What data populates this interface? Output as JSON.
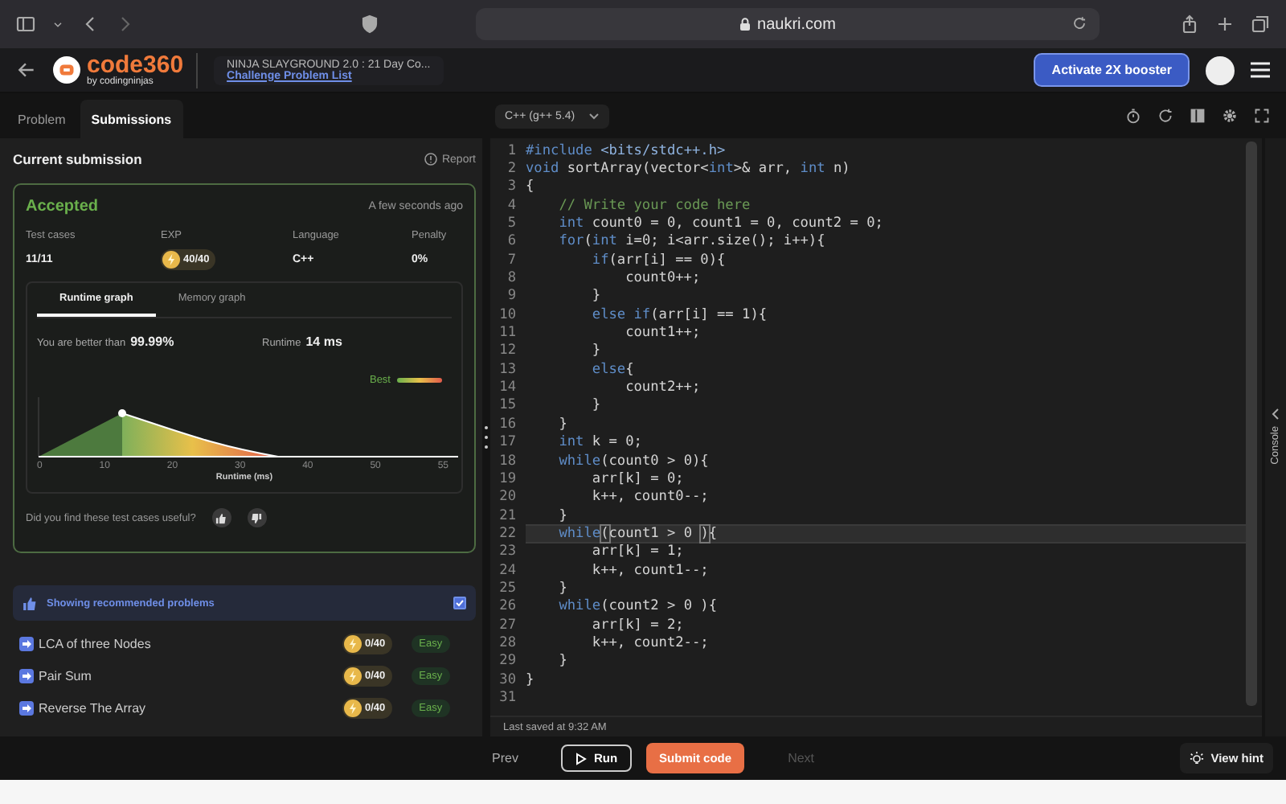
{
  "browser": {
    "url": "naukri.com"
  },
  "header": {
    "logo": {
      "name": "code360",
      "byline": "by codingninjas"
    },
    "title": "NINJA SLAYGROUND 2.0 : 21 Day Co...",
    "link": "Challenge Problem List",
    "booster_button": "Activate 2X booster"
  },
  "tabs": [
    {
      "label": "Problem",
      "selected": false
    },
    {
      "label": "Submissions",
      "selected": true
    }
  ],
  "submission": {
    "heading": "Current submission",
    "report": "Report",
    "status": "Accepted",
    "time": "A few seconds ago",
    "stats": [
      {
        "label": "Test cases",
        "value": "11/11",
        "kind": "text"
      },
      {
        "label": "EXP",
        "value": "40/40",
        "kind": "coin"
      },
      {
        "label": "Language",
        "value": "C++",
        "kind": "text"
      },
      {
        "label": "Penalty",
        "value": "0%",
        "kind": "text"
      }
    ],
    "graph_tabs": [
      {
        "label": "Runtime graph",
        "selected": true
      },
      {
        "label": "Memory graph",
        "selected": false
      }
    ],
    "better_than_label": "You are better than",
    "better_than_value": "99.99%",
    "runtime_label": "Runtime",
    "runtime_value": "14 ms",
    "legend": "Best",
    "x_ticks": [
      "0",
      "10",
      "20",
      "30",
      "40",
      "50",
      "55"
    ],
    "x_label": "Runtime (ms)",
    "feedback_question": "Did you find these test cases useful?"
  },
  "recommended": {
    "label": "Showing recommended problems",
    "checked": true,
    "problems": [
      {
        "title": "LCA of three Nodes",
        "exp": "0/40",
        "difficulty": "Easy"
      },
      {
        "title": "Pair Sum",
        "exp": "0/40",
        "difficulty": "Easy"
      },
      {
        "title": "Reverse The Array",
        "exp": "0/40",
        "difficulty": "Easy"
      }
    ]
  },
  "editor": {
    "language": "C++ (g++ 5.4)",
    "last_saved": "Last saved at 9:32 AM",
    "console_label": "Console",
    "lines": [
      {
        "number": "1",
        "current": false,
        "tokens": [
          {
            "kind": "keyword",
            "text": "#include"
          },
          {
            "kind": "string",
            "text": " <bits/stdc++.h>"
          }
        ]
      },
      {
        "number": "2",
        "current": false,
        "tokens": [
          {
            "kind": "keyword",
            "text": "void"
          },
          {
            "kind": "plain",
            "text": " sortArray(vector<"
          },
          {
            "kind": "keyword",
            "text": "int"
          },
          {
            "kind": "plain",
            "text": ">& arr, "
          },
          {
            "kind": "keyword",
            "text": "int"
          },
          {
            "kind": "plain",
            "text": " n)"
          }
        ]
      },
      {
        "number": "3",
        "current": false,
        "tokens": [
          {
            "kind": "plain",
            "text": "{"
          }
        ]
      },
      {
        "number": "4",
        "current": false,
        "tokens": [
          {
            "kind": "comment",
            "text": "    // Write your code here"
          }
        ]
      },
      {
        "number": "5",
        "current": false,
        "tokens": [
          {
            "kind": "keyword",
            "text": "    int"
          },
          {
            "kind": "plain",
            "text": " count0 = 0, count1 = 0, count2 = 0;"
          }
        ]
      },
      {
        "number": "6",
        "current": false,
        "tokens": [
          {
            "kind": "keyword",
            "text": "    for"
          },
          {
            "kind": "plain",
            "text": "("
          },
          {
            "kind": "keyword",
            "text": "int"
          },
          {
            "kind": "plain",
            "text": " i=0; i<arr.size(); i++){"
          }
        ]
      },
      {
        "number": "7",
        "current": false,
        "tokens": [
          {
            "kind": "keyword",
            "text": "        if"
          },
          {
            "kind": "plain",
            "text": "(arr[i] == 0){"
          }
        ]
      },
      {
        "number": "8",
        "current": false,
        "tokens": [
          {
            "kind": "plain",
            "text": "            count0++;"
          }
        ]
      },
      {
        "number": "9",
        "current": false,
        "tokens": [
          {
            "kind": "plain",
            "text": "        }"
          }
        ]
      },
      {
        "number": "10",
        "current": false,
        "tokens": [
          {
            "kind": "keyword",
            "text": "        else if"
          },
          {
            "kind": "plain",
            "text": "(arr[i] == 1){"
          }
        ]
      },
      {
        "number": "11",
        "current": false,
        "tokens": [
          {
            "kind": "plain",
            "text": "            count1++;"
          }
        ]
      },
      {
        "number": "12",
        "current": false,
        "tokens": [
          {
            "kind": "plain",
            "text": "        }"
          }
        ]
      },
      {
        "number": "13",
        "current": false,
        "tokens": [
          {
            "kind": "keyword",
            "text": "        else"
          },
          {
            "kind": "plain",
            "text": "{"
          }
        ]
      },
      {
        "number": "14",
        "current": false,
        "tokens": [
          {
            "kind": "plain",
            "text": "            count2++;"
          }
        ]
      },
      {
        "number": "15",
        "current": false,
        "tokens": [
          {
            "kind": "plain",
            "text": "        }"
          }
        ]
      },
      {
        "number": "16",
        "current": false,
        "tokens": [
          {
            "kind": "plain",
            "text": "    }"
          }
        ]
      },
      {
        "number": "17",
        "current": false,
        "tokens": [
          {
            "kind": "keyword",
            "text": "    int"
          },
          {
            "kind": "plain",
            "text": " k = 0;"
          }
        ]
      },
      {
        "number": "18",
        "current": false,
        "tokens": [
          {
            "kind": "keyword",
            "text": "    while"
          },
          {
            "kind": "plain",
            "text": "(count0 > 0){"
          }
        ]
      },
      {
        "number": "19",
        "current": false,
        "tokens": [
          {
            "kind": "plain",
            "text": "        arr[k] = 0;"
          }
        ]
      },
      {
        "number": "20",
        "current": false,
        "tokens": [
          {
            "kind": "plain",
            "text": "        k++, count0--;"
          }
        ]
      },
      {
        "number": "21",
        "current": false,
        "tokens": [
          {
            "kind": "plain",
            "text": "    }"
          }
        ]
      },
      {
        "number": "22",
        "current": true,
        "tokens": [
          {
            "kind": "keyword",
            "text": "    while"
          },
          {
            "kind": "match",
            "text": "("
          },
          {
            "kind": "plain",
            "text": "count1 > 0 "
          },
          {
            "kind": "match",
            "text": ")"
          },
          {
            "kind": "plain",
            "text": "{"
          }
        ]
      },
      {
        "number": "23",
        "current": false,
        "tokens": [
          {
            "kind": "plain",
            "text": "        arr[k] = 1;"
          }
        ]
      },
      {
        "number": "24",
        "current": false,
        "tokens": [
          {
            "kind": "plain",
            "text": "        k++, count1--;"
          }
        ]
      },
      {
        "number": "25",
        "current": false,
        "tokens": [
          {
            "kind": "plain",
            "text": "    }"
          }
        ]
      },
      {
        "number": "26",
        "current": false,
        "tokens": [
          {
            "kind": "keyword",
            "text": "    while"
          },
          {
            "kind": "plain",
            "text": "(count2 > 0 ){"
          }
        ]
      },
      {
        "number": "27",
        "current": false,
        "tokens": [
          {
            "kind": "plain",
            "text": "        arr[k] = 2;"
          }
        ]
      },
      {
        "number": "28",
        "current": false,
        "tokens": [
          {
            "kind": "plain",
            "text": "        k++, count2--;"
          }
        ]
      },
      {
        "number": "29",
        "current": false,
        "tokens": [
          {
            "kind": "plain",
            "text": "    }"
          }
        ]
      },
      {
        "number": "30",
        "current": false,
        "tokens": [
          {
            "kind": "plain",
            "text": "}"
          }
        ]
      },
      {
        "number": "31",
        "current": false
      }
    ]
  },
  "footer": {
    "prev": "Prev",
    "run": "Run",
    "submit": "Submit code",
    "next": {
      "label": "Next",
      "disabled": true
    },
    "hint": "View hint"
  }
}
